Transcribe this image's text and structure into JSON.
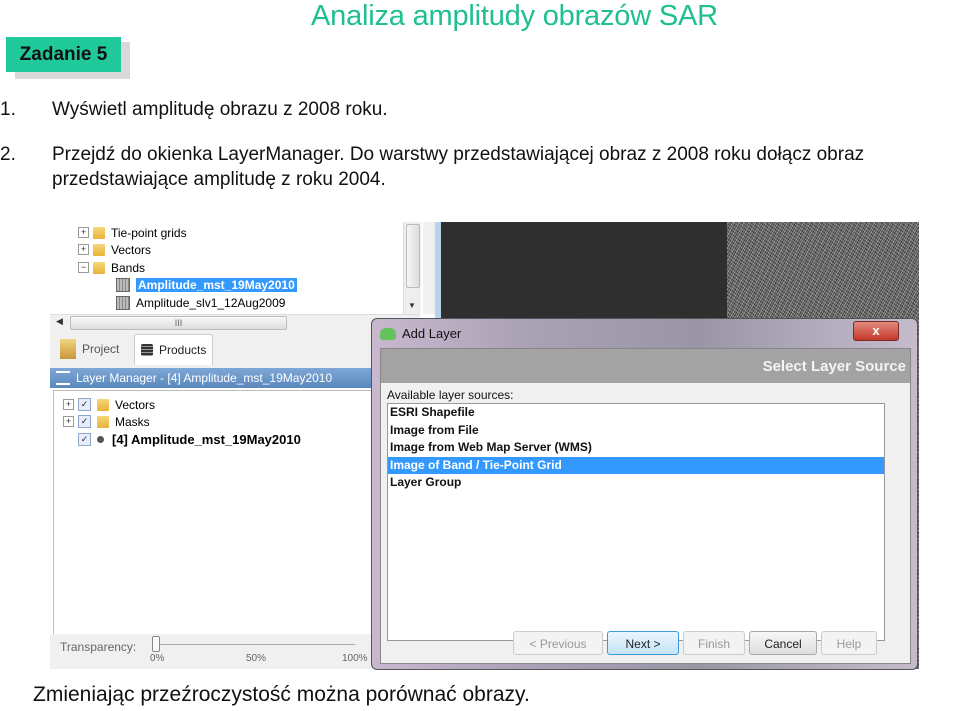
{
  "slide": {
    "title": "Analiza amplitudy obrazów SAR",
    "task_badge": "Zadanie 5",
    "steps": [
      {
        "num": "1.",
        "text": "Wyświetl amplitudę obrazu z 2008 roku."
      },
      {
        "num": "2.",
        "text_line1": "Przejdź do okienka LayerManager. Do warstwy przedstawiającej obraz z 2008 roku dołącz obraz",
        "text_line2": "przedstawiające amplitudę z roku 2004."
      }
    ],
    "footer": "Zmieniając przeźroczystość można porównać obrazy.",
    "accent_color": "#1fc99a"
  },
  "product_tree": {
    "items": [
      {
        "label": "Tie-point grids",
        "expander": "+",
        "icon": "folder-icon"
      },
      {
        "label": "Vectors",
        "expander": "+",
        "icon": "folder-icon"
      },
      {
        "label": "Bands",
        "expander": "−",
        "icon": "folder-icon"
      },
      {
        "label": "Amplitude_mst_19May2010",
        "icon": "band-icon",
        "selected": true
      },
      {
        "label": "Amplitude_slv1_12Aug2009",
        "icon": "band-icon"
      }
    ],
    "hscroll_grip": "III"
  },
  "tabs": [
    {
      "label": "Project",
      "icon": "project-icon"
    },
    {
      "label": "Products",
      "icon": "database-icon",
      "active": true
    }
  ],
  "layer_manager": {
    "title": "Layer Manager - [4] Amplitude_mst_19May2010",
    "layers": [
      {
        "label": "Vectors",
        "expander": "+",
        "checked": true
      },
      {
        "label": "Masks",
        "expander": "+",
        "checked": true
      },
      {
        "label": "[4] Amplitude_mst_19May2010",
        "checked": true
      }
    ],
    "transparency": {
      "label": "Transparency:",
      "value_percent": 0,
      "ticks": [
        "0%",
        "50%",
        "100%"
      ]
    }
  },
  "add_layer_dialog": {
    "title": "Add Layer",
    "close": "x",
    "header": "Select Layer Source",
    "available_label": "Available layer sources:",
    "sources": [
      "ESRI Shapefile",
      "Image from File",
      "Image from Web Map Server (WMS)",
      "Image of Band / Tie-Point Grid",
      "Layer Group"
    ],
    "selected_index": 3,
    "buttons": {
      "previous": "< Previous",
      "next": "Next >",
      "finish": "Finish",
      "cancel": "Cancel",
      "help": "Help"
    }
  }
}
